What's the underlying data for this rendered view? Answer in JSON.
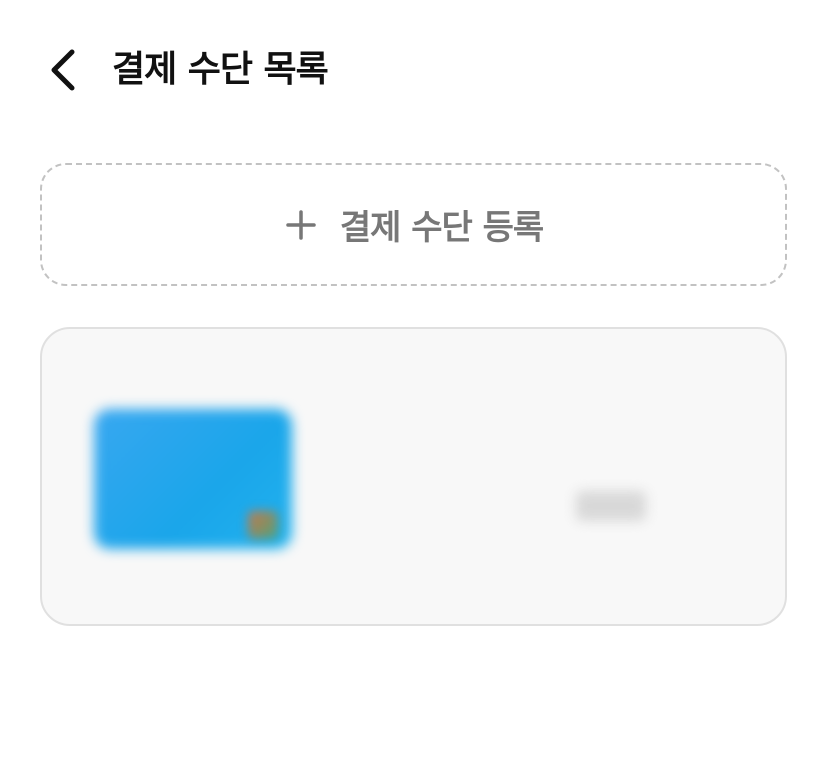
{
  "header": {
    "back_icon": "chevron-left-icon",
    "title": "결제 수단 목록"
  },
  "add_payment": {
    "icon": "plus-icon",
    "label": "결제 수단 등록",
    "border_color": "#c2c2c2",
    "text_color": "#777777"
  },
  "payment_methods": [
    {
      "card_image_color": "#1aa6ea",
      "name": "",
      "number": ""
    }
  ],
  "colors": {
    "card_background": "#f8f8f8",
    "card_border": "#e0e0e0",
    "title_text": "#111111"
  }
}
